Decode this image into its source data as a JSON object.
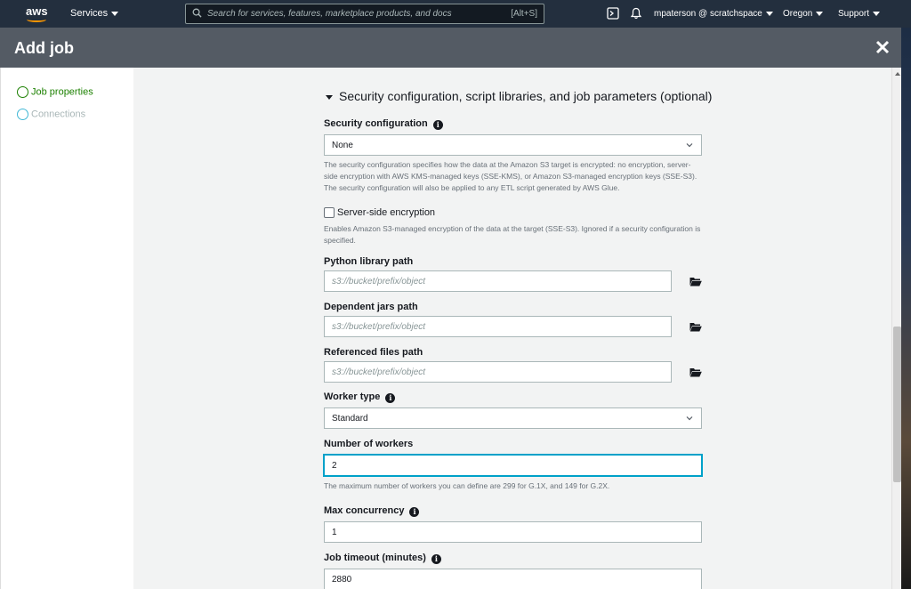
{
  "topnav": {
    "logo": "aws",
    "services": "Services",
    "search_placeholder": "Search for services, features, marketplace products, and docs",
    "search_shortcut": "[Alt+S]",
    "user": "mpaterson @ scratchspace",
    "region": "Oregon",
    "support": "Support"
  },
  "modal": {
    "title": "Add job"
  },
  "sidebar": {
    "steps": [
      {
        "label": "Job properties",
        "color": "#1d8102"
      },
      {
        "label": "Connections",
        "color": "#44b9d6"
      }
    ]
  },
  "section": {
    "title": "Security configuration, script libraries, and job parameters (optional)"
  },
  "fields": {
    "security_configuration": {
      "label": "Security configuration",
      "value": "None",
      "help": "The security configuration specifies how the data at the Amazon S3 target is encrypted: no encryption, server-side encryption with AWS KMS-managed keys (SSE-KMS), or Amazon S3-managed encryption keys (SSE-S3). The security configuration will also be applied to any ETL script generated by AWS Glue."
    },
    "server_side_encryption": {
      "label": "Server-side encryption",
      "checked": false,
      "help": "Enables Amazon S3-managed encryption of the data at the target (SSE-S3). Ignored if a security configuration is specified."
    },
    "python_library_path": {
      "label": "Python library path",
      "placeholder": "s3://bucket/prefix/object"
    },
    "dependent_jars_path": {
      "label": "Dependent jars path",
      "placeholder": "s3://bucket/prefix/object"
    },
    "referenced_files_path": {
      "label": "Referenced files path",
      "placeholder": "s3://bucket/prefix/object"
    },
    "worker_type": {
      "label": "Worker type",
      "value": "Standard"
    },
    "number_of_workers": {
      "label": "Number of workers",
      "value": "2",
      "help": "The maximum number of workers you can define are 299 for G.1X, and 149 for G.2X."
    },
    "max_concurrency": {
      "label": "Max concurrency",
      "value": "1"
    },
    "job_timeout": {
      "label": "Job timeout (minutes)",
      "value": "2880"
    }
  }
}
